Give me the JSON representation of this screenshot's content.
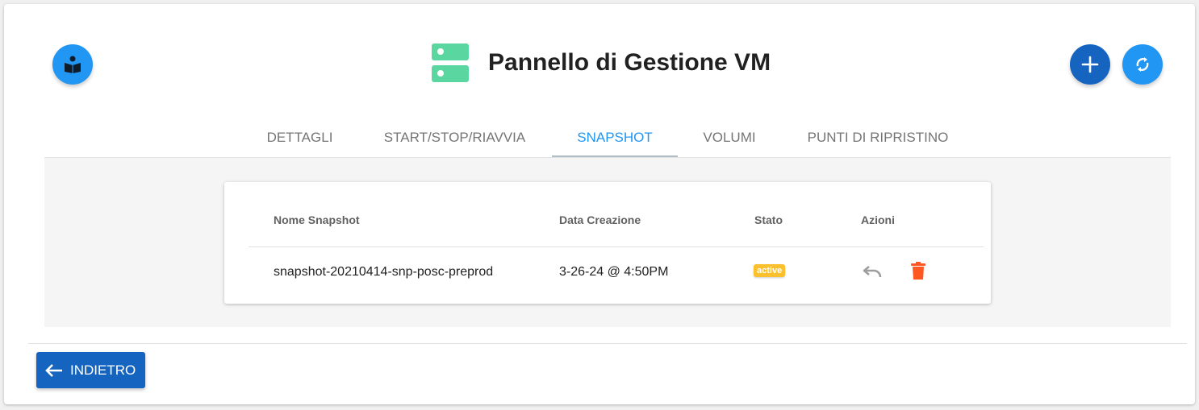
{
  "header": {
    "title": "Pannello di Gestione VM",
    "icons": {
      "doc_button": "book-reader-icon",
      "title": "server-icon",
      "add_button": "plus-icon",
      "refresh_button": "refresh-icon"
    }
  },
  "tabs": [
    {
      "label": "DETTAGLI",
      "active": false
    },
    {
      "label": "START/STOP/RIAVVIA",
      "active": false
    },
    {
      "label": "SNAPSHOT",
      "active": true
    },
    {
      "label": "VOLUMI",
      "active": false
    },
    {
      "label": "PUNTI DI RIPRISTINO",
      "active": false
    }
  ],
  "table": {
    "headers": [
      "Nome Snapshot",
      "Data Creazione",
      "Stato",
      "Azioni"
    ],
    "rows": [
      {
        "name": "snapshot-20210414-snp-posc-preprod",
        "created": "3-26-24 @ 4:50PM",
        "status": "active",
        "actions": [
          "undo-icon",
          "trash-icon"
        ]
      }
    ]
  },
  "footer": {
    "back_label": "INDIETRO",
    "back_icon": "arrow-left-icon"
  },
  "colors": {
    "primary": "#2196f3",
    "primary_dark": "#1565c0",
    "server_icon": "#5ad7a1",
    "status_active": "#fbc02d",
    "delete": "#ff5722"
  }
}
